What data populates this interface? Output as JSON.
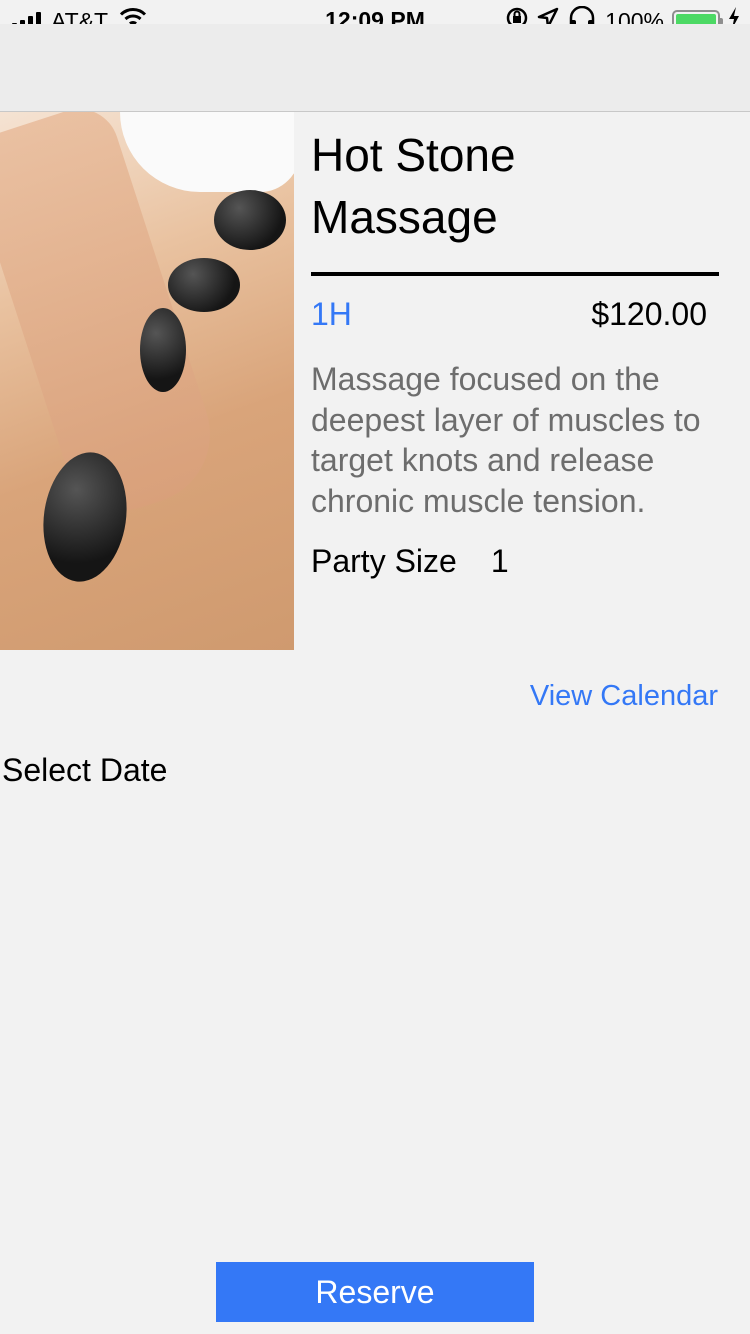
{
  "status_bar": {
    "carrier": "AT&T",
    "time": "12:09 PM",
    "battery_percent": "100%",
    "battery_level": 1.0,
    "icons": [
      "signal-icon",
      "wifi-icon",
      "rotation-lock-icon",
      "location-icon",
      "headphones-icon",
      "battery-icon",
      "charging-icon"
    ]
  },
  "service": {
    "title_line1": "Hot Stone",
    "title_line2": "Massage",
    "duration": "1H",
    "price": "$120.00",
    "description": "Massage focused on the deepest layer of muscles to target knots and release chronic muscle tension.",
    "party_size_label": "Party Size",
    "party_size_value": "1"
  },
  "actions": {
    "view_calendar": "View Calendar",
    "select_date": "Select Date",
    "reserve": "Reserve"
  },
  "colors": {
    "accent": "#3478f6",
    "background": "#f2f2f2",
    "description_text": "#6d6d6d",
    "battery": "#4cd964"
  }
}
